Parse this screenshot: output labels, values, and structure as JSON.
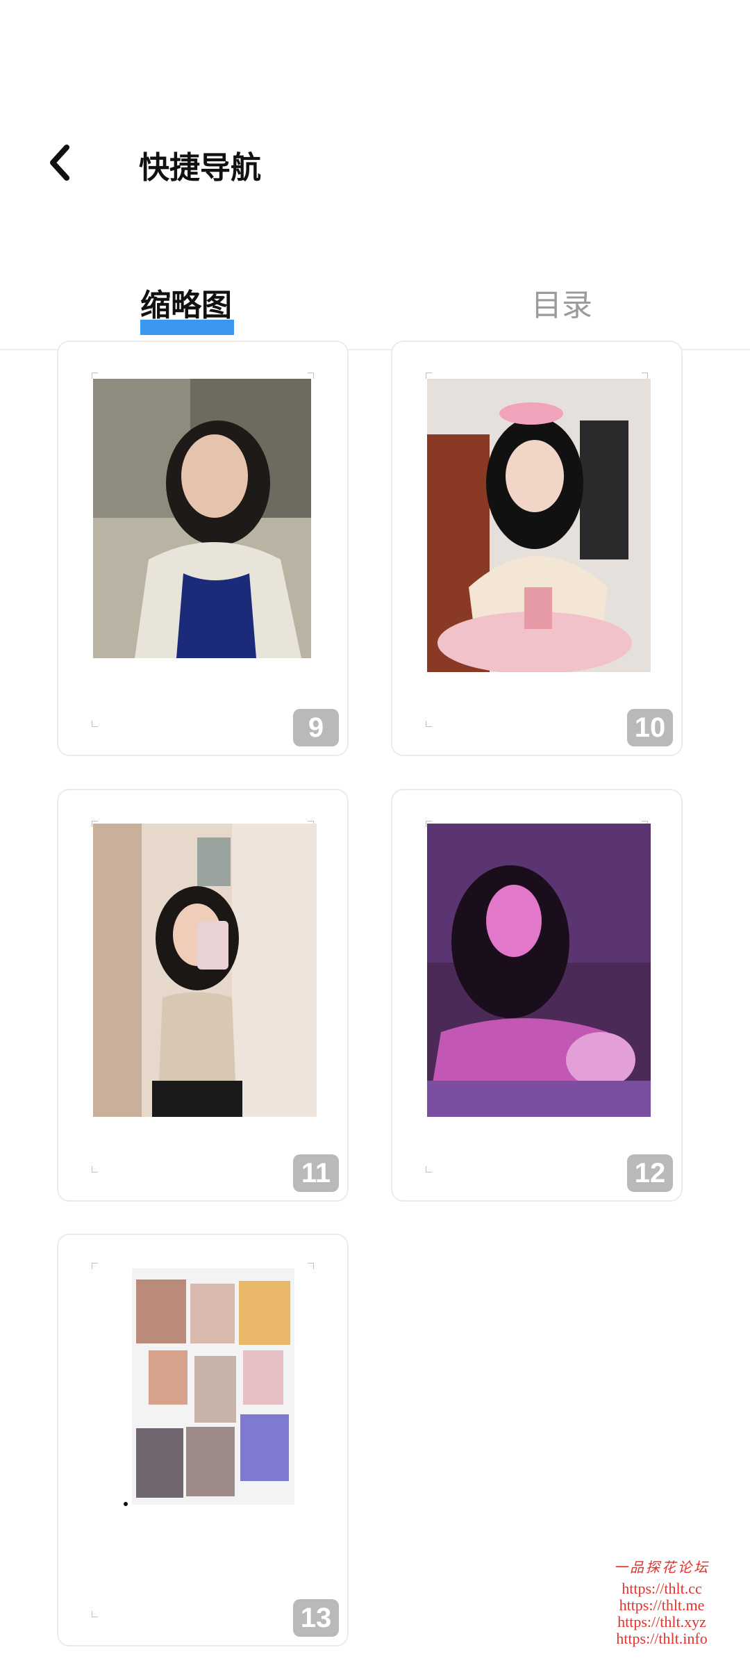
{
  "header": {
    "back_icon": "chevron-left-icon",
    "title": "快捷导航"
  },
  "tabs": [
    {
      "label": "缩略图",
      "active": true
    },
    {
      "label": "目录",
      "active": false
    }
  ],
  "colors": {
    "accent": "#3a98f0",
    "inactive_tab": "#9b9b9b",
    "page_badge": "#b9b9b9"
  },
  "pages": [
    {
      "number": "9"
    },
    {
      "number": "10"
    },
    {
      "number": "11"
    },
    {
      "number": "12"
    },
    {
      "number": "13"
    }
  ],
  "watermark": {
    "title": "一品探花论坛",
    "lines": [
      "https://thlt.cc",
      "https://thlt.me",
      "https://thlt.xyz",
      "https://thlt.info"
    ]
  }
}
